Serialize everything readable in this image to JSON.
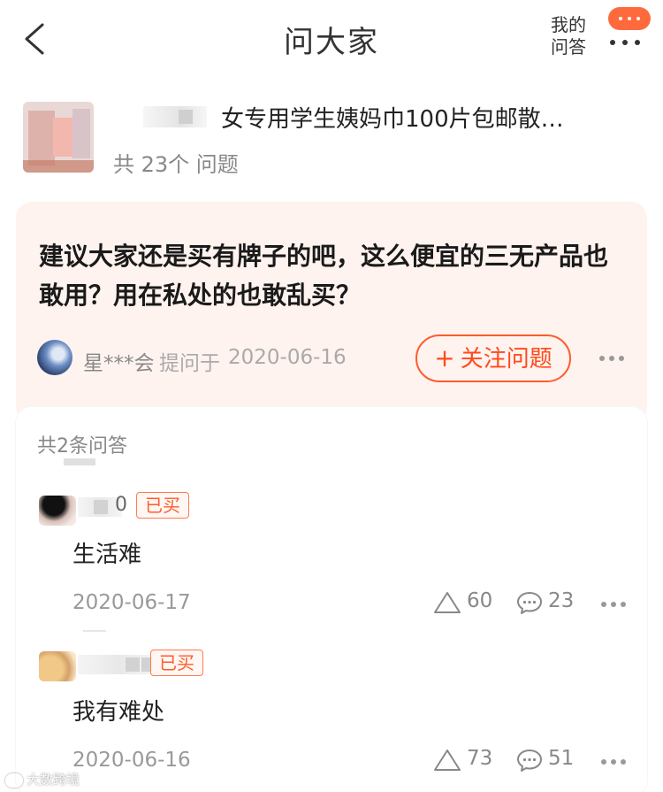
{
  "header": {
    "title": "问大家",
    "my_qa_line1": "我的",
    "my_qa_line2": "问答"
  },
  "product": {
    "title": "女专用学生姨妈巾100片包邮散…",
    "question_count": "共 23个 问题"
  },
  "question": {
    "text": "建议大家还是买有牌子的吧，这么便宜的三无产品也敢用？用在私处的也敢乱买？",
    "asker": "星***会",
    "asked_label": "提问于",
    "asked_date": "2020-06-16",
    "follow_label": "关注问题",
    "follow_icon": "plus-icon"
  },
  "answers_section": {
    "count_label": "共2条问答",
    "answers": [
      {
        "name_tail": "0",
        "tag": "已买",
        "text": "生活难",
        "date": "2020-06-17",
        "likes": "60",
        "comments": "23"
      },
      {
        "name_tail": "",
        "tag": "已买",
        "text": "我有难处",
        "date": "2020-06-16",
        "likes": "73",
        "comments": "51"
      }
    ]
  },
  "watermark": "大数跨境",
  "colors": {
    "accent": "#ff5b2c",
    "card_bg": "#fff3ef",
    "badge": "#ff6a3d"
  }
}
